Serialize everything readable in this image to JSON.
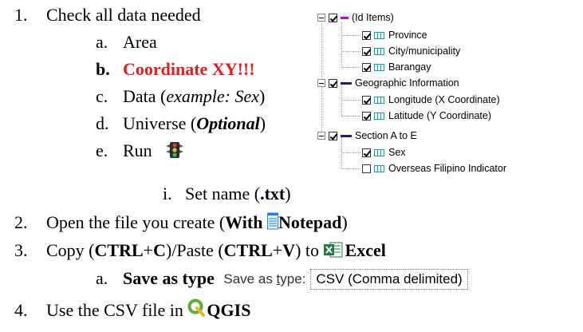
{
  "steps": {
    "s1": {
      "num": "1.",
      "text": "Check all data needed"
    },
    "s1a": {
      "num": "a.",
      "text": "Area"
    },
    "s1b": {
      "num": "b.",
      "text": "Coordinate XY!!!"
    },
    "s1c": {
      "num": "c.",
      "pre": "Data (",
      "italic": "example: Sex",
      "post": ")"
    },
    "s1d": {
      "num": "d.",
      "pre": "Universe (",
      "italic": "Optional",
      "post": ")"
    },
    "s1e": {
      "num": "e.",
      "text": "Run"
    },
    "s1ei": {
      "num": "i.",
      "pre": "Set name (",
      "bold": ".txt",
      "post": ")"
    },
    "s2": {
      "num": "2.",
      "pre": "Open the file you create (",
      "bold1": "With ",
      "bold2": "Notepad",
      "post": ")"
    },
    "s3": {
      "num": "3.",
      "pre": "Copy (",
      "b1": "CTRL",
      "m1": "+",
      "b2": "C",
      "m2": ")/Paste (",
      "b3": "CTRL",
      "m3": "+",
      "b4": "V",
      "m4": ") to ",
      "b5": "Excel"
    },
    "s3a": {
      "num": "a.",
      "bold": "Save as type",
      "lbl_pre": "Save as ",
      "lbl_u": "t",
      "lbl_post": "ype:",
      "value": "CSV (Comma delimited)"
    },
    "s4": {
      "num": "4.",
      "pre": "Use the CSV file in ",
      "bold": "QGIS"
    }
  },
  "tree": {
    "root": {
      "label": "(Id Items)"
    },
    "id_items": [
      {
        "label": "Province",
        "checked": true
      },
      {
        "label": "City/municipality",
        "checked": true
      },
      {
        "label": "Barangay",
        "checked": true
      }
    ],
    "geo": {
      "label": "Geographic Information"
    },
    "geo_items": [
      {
        "label": "Longitude (X Coordinate)",
        "checked": true
      },
      {
        "label": "Latitude (Y Coordinate)",
        "checked": true
      }
    ],
    "section": {
      "label": "Section A to E"
    },
    "section_items": [
      {
        "label": "Sex",
        "checked": true
      },
      {
        "label": "Overseas Filipino Indicator",
        "checked": false
      }
    ]
  },
  "icons": {
    "run": "traffic-light-icon",
    "notepad": "notepad-icon",
    "excel": "excel-icon",
    "qgis": "qgis-icon"
  },
  "colors": {
    "accent_red": "#e02020",
    "excel_green": "#1f7a45",
    "qgis_green": "#5cae3a"
  }
}
